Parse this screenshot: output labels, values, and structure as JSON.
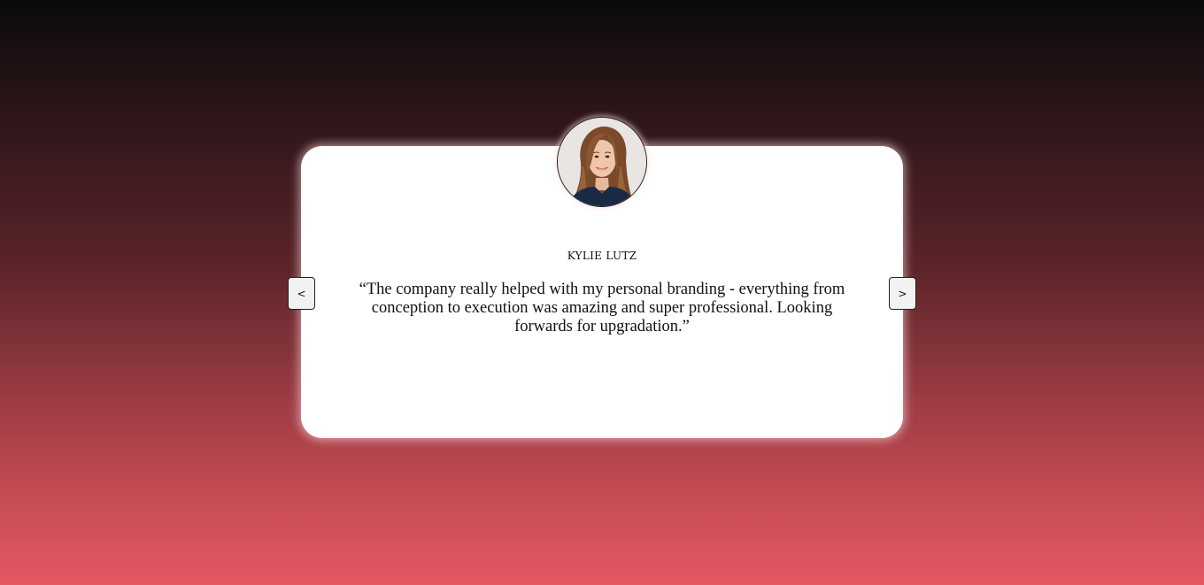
{
  "testimonial": {
    "name": "KYLIE LUTZ",
    "quote": "“The company really helped with my personal branding - everything from conception to execution was amazing and super professional. Looking forwards for upgradation.”",
    "avatar_icon": "person-photo-icon"
  },
  "navigation": {
    "prev_label": "<",
    "next_label": ">"
  },
  "colors": {
    "background_top": "#0a0a0a",
    "background_bottom": "#e65762",
    "card": "#ffffff",
    "button_bg": "#f3f2f3",
    "text": "#111111"
  }
}
